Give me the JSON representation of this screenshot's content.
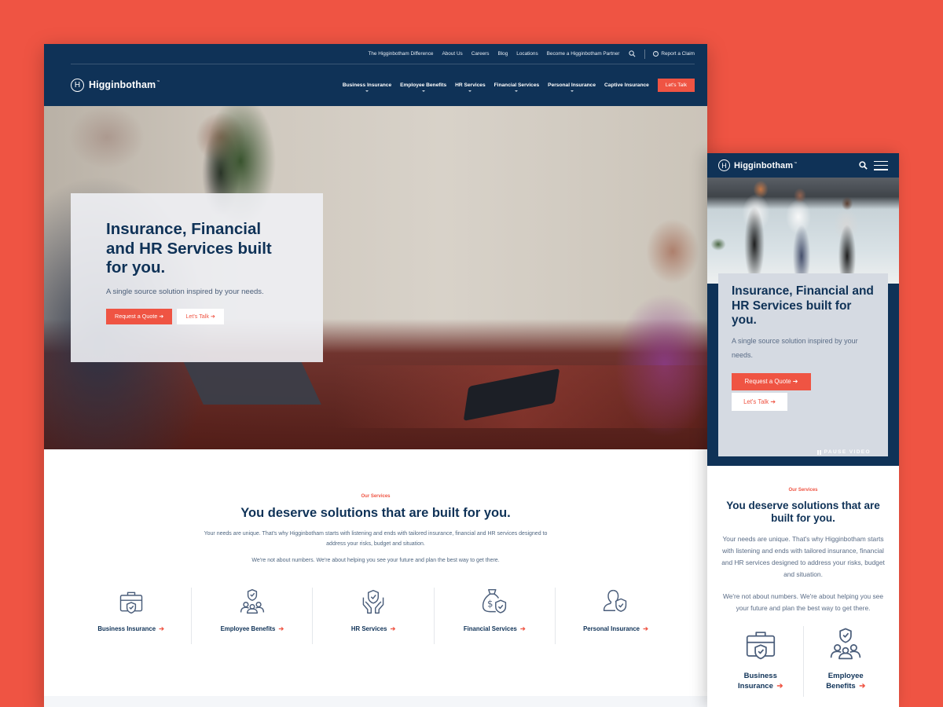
{
  "colors": {
    "brand_navy": "#0f3257",
    "accent": "#ef5443",
    "background": "#ef5443"
  },
  "desktop": {
    "utility_nav": [
      "The Higginbotham Difference",
      "About Us",
      "Careers",
      "Blog",
      "Locations",
      "Become a Higginbotham Partner"
    ],
    "search_icon": "search-icon",
    "report_claim": "Report a Claim",
    "logo": {
      "mark": "H",
      "text": "Higginbotham",
      "tm": "™"
    },
    "main_nav": [
      {
        "label": "Business Insurance",
        "has_dropdown": true
      },
      {
        "label": "Employee Benefits",
        "has_dropdown": true
      },
      {
        "label": "HR Services",
        "has_dropdown": true
      },
      {
        "label": "Financial Services",
        "has_dropdown": true
      },
      {
        "label": "Personal Insurance",
        "has_dropdown": true
      },
      {
        "label": "Captive Insurance",
        "has_dropdown": false
      }
    ],
    "cta": "Let's Talk",
    "hero": {
      "title": "Insurance, Financial and HR Services built for you.",
      "subtitle": "A single source solution inspired by your needs.",
      "primary_btn": "Request a Quote",
      "secondary_btn": "Let's Talk",
      "arrow": "➔"
    },
    "services": {
      "eyebrow": "Our Services",
      "title": "You deserve solutions that are built for you.",
      "paragraph1": "Your needs are unique. That's why Higginbotham starts with listening and ends with tailored insurance, financial and HR services designed to address your risks, budget and situation.",
      "paragraph2": "We're not about numbers. We're about helping you see your future and plan the best way to get there.",
      "items": [
        {
          "label": "Business Insurance",
          "icon": "briefcase-shield-icon"
        },
        {
          "label": "Employee Benefits",
          "icon": "people-shield-icon"
        },
        {
          "label": "HR Services",
          "icon": "hands-shield-icon"
        },
        {
          "label": "Financial Services",
          "icon": "moneybag-shield-icon"
        },
        {
          "label": "Personal Insurance",
          "icon": "person-shield-icon"
        }
      ],
      "arrow": "➔"
    }
  },
  "mobile": {
    "logo": {
      "mark": "H",
      "text": "Higginbotham",
      "tm": "™"
    },
    "hero": {
      "title": "Insurance, Financial and HR Services built for you.",
      "subtitle": "A single source solution inspired by your needs.",
      "primary_btn": "Request a Quote",
      "secondary_btn": "Let's Talk",
      "pause_label": "PAUSE VIDEO",
      "arrow": "➔"
    },
    "services": {
      "eyebrow": "Our Services",
      "title": "You deserve solutions that are built for you.",
      "paragraph1": "Your needs are unique. That's why Higginbotham starts with listening and ends with tailored insurance, financial and HR services designed to address your risks, budget and situation.",
      "paragraph2": "We're not about numbers. We're about helping you see your future and plan the best way to get there.",
      "items": [
        {
          "label": "Business Insurance",
          "icon": "briefcase-shield-icon"
        },
        {
          "label": "Employee Benefits",
          "icon": "people-shield-icon"
        }
      ],
      "arrow": "➔"
    }
  }
}
